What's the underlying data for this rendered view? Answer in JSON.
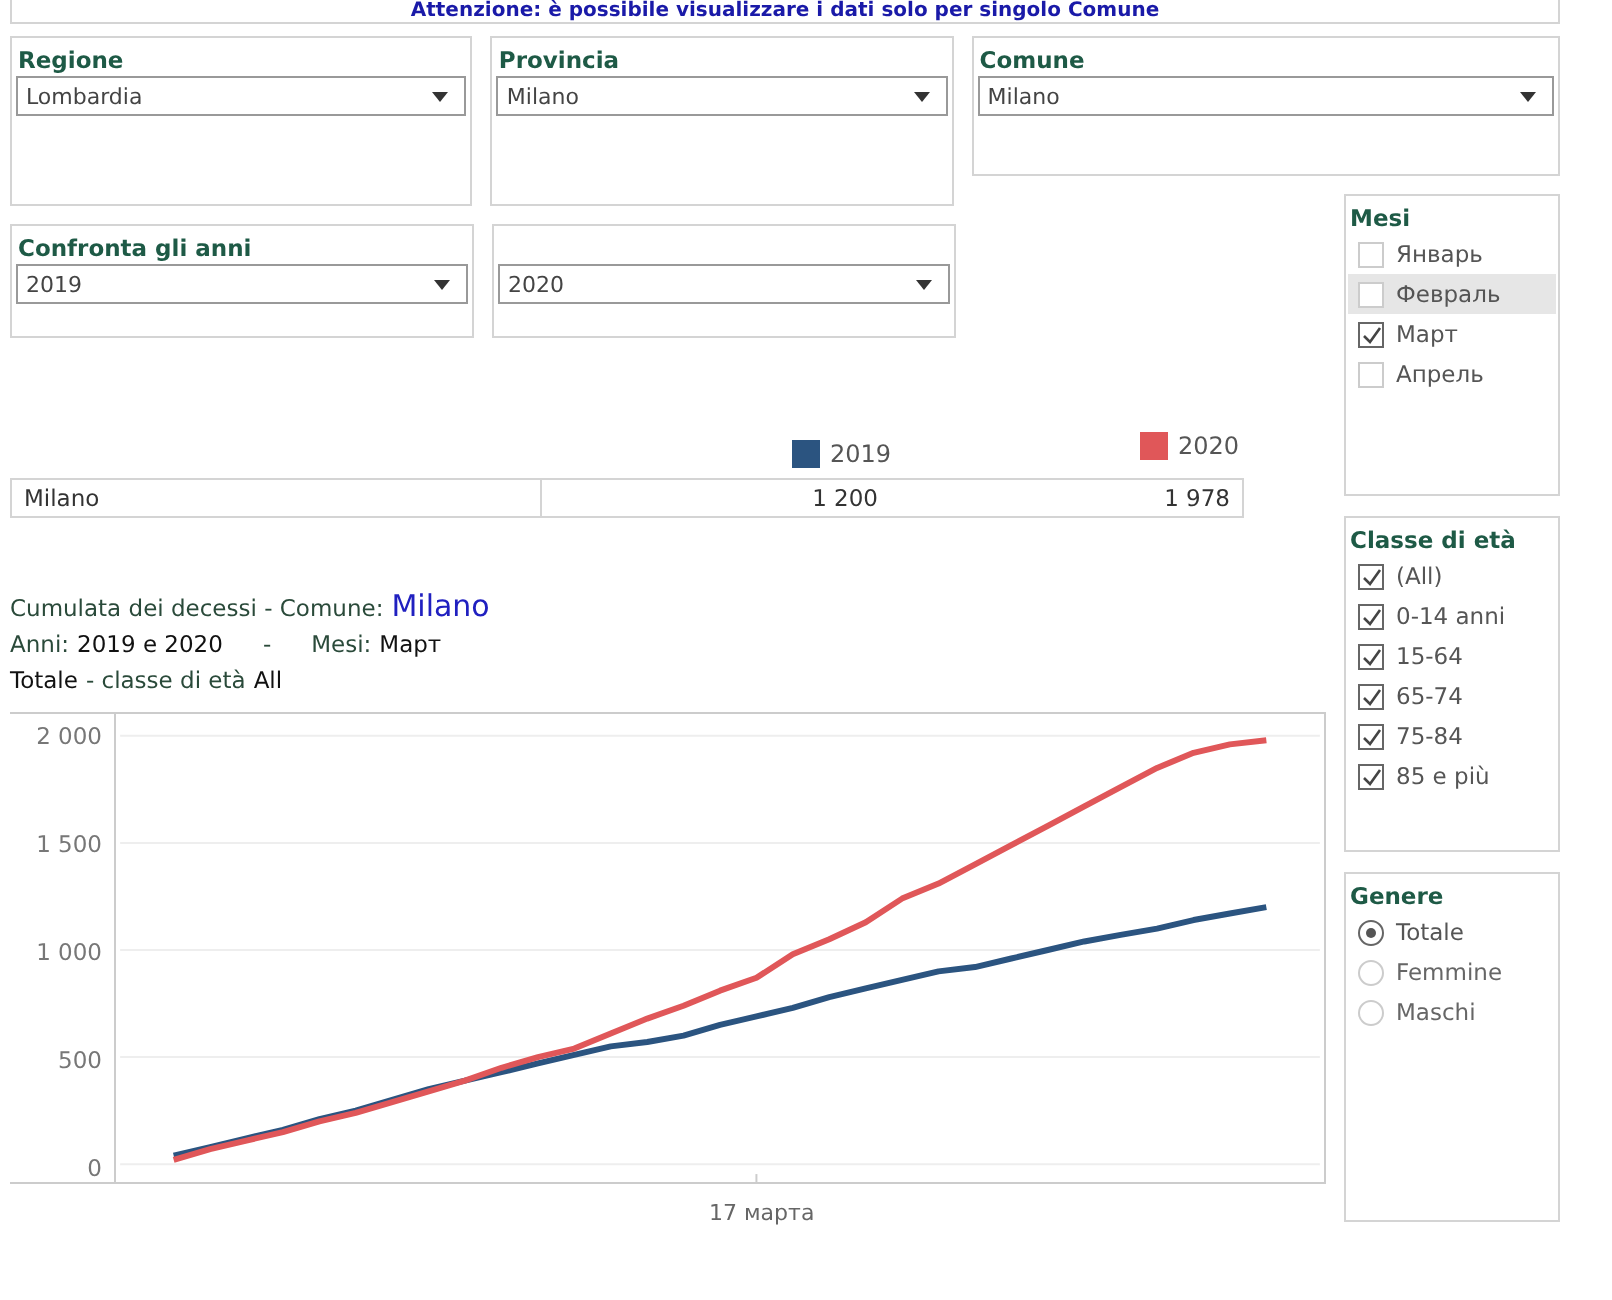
{
  "banner": "Attenzione: è possibile visualizzare i dati solo per singolo Comune",
  "filters": [
    {
      "label": "Regione",
      "value": "Lombardia"
    },
    {
      "label": "Provincia",
      "value": "Milano"
    },
    {
      "label": "Comune",
      "value": "Milano"
    }
  ],
  "compare": {
    "label": "Confronta gli anni",
    "year_a": "2019",
    "year_b": "2020"
  },
  "table": {
    "rows": [
      {
        "name": "Milano",
        "value_a": "1 200",
        "value_b": "1 978"
      }
    ]
  },
  "chart_title": {
    "prefix": "Cumulata dei decessi -  Comune:",
    "comune": "Milano",
    "years_label": "Anni:",
    "years": "2019 e 2020",
    "separator": "-",
    "months_label": "Mesi:",
    "months": "Март",
    "total": "Totale",
    "class_label": "- classe di età",
    "class_value": "All"
  },
  "chart": {
    "x_label": "17 марта",
    "chart_data": {
      "type": "line",
      "grid": true,
      "ylim": [
        0,
        2000
      ],
      "yticks": [
        {
          "value": 0,
          "label": "0"
        },
        {
          "value": 500,
          "label": "500"
        },
        {
          "value": 1000,
          "label": "1 000"
        },
        {
          "value": 1500,
          "label": "1 500"
        },
        {
          "value": 2000,
          "label": "2 000"
        }
      ],
      "series": [
        {
          "name": "2019",
          "color": "#2b5480",
          "values": [
            40,
            80,
            120,
            160,
            210,
            250,
            300,
            350,
            390,
            430,
            470,
            510,
            550,
            570,
            600,
            650,
            690,
            730,
            780,
            820,
            860,
            900,
            920,
            960,
            1000,
            1040,
            1070,
            1100,
            1140,
            1170,
            1200
          ]
        },
        {
          "name": "2020",
          "color": "#e05759",
          "values": [
            20,
            70,
            110,
            150,
            200,
            240,
            290,
            340,
            390,
            450,
            500,
            540,
            610,
            680,
            740,
            810,
            870,
            980,
            1050,
            1130,
            1240,
            1310,
            1400,
            1490,
            1580,
            1670,
            1760,
            1850,
            1920,
            1960,
            1980
          ]
        }
      ]
    }
  },
  "months": {
    "title": "Mesi",
    "items": [
      {
        "label": "Январь",
        "checked": false,
        "highlighted": false
      },
      {
        "label": "Февраль",
        "checked": false,
        "highlighted": true
      },
      {
        "label": "Март",
        "checked": true,
        "highlighted": false
      },
      {
        "label": "Апрель",
        "checked": false,
        "highlighted": false
      }
    ]
  },
  "age_classes": {
    "title": "Classe di età",
    "items": [
      {
        "label": "(All)",
        "checked": true
      },
      {
        "label": "0-14 anni",
        "checked": true
      },
      {
        "label": "15-64",
        "checked": true
      },
      {
        "label": "65-74",
        "checked": true
      },
      {
        "label": "75-84",
        "checked": true
      },
      {
        "label": "85 e più",
        "checked": true
      }
    ]
  },
  "gender": {
    "title": "Genere",
    "items": [
      {
        "label": "Totale",
        "selected": true
      },
      {
        "label": "Femmine",
        "selected": false
      },
      {
        "label": "Maschi",
        "selected": false
      }
    ]
  }
}
